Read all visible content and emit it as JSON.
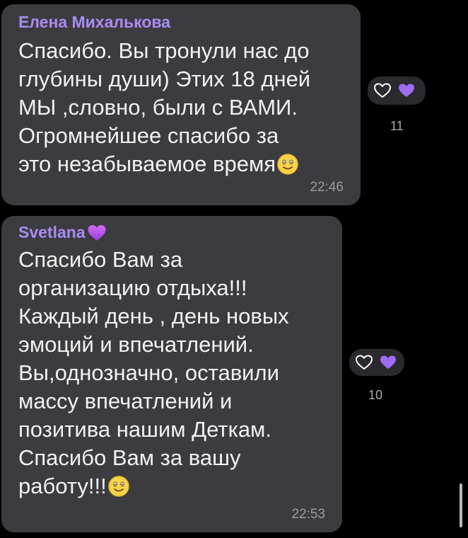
{
  "messages": [
    {
      "sender": "Елена Михалькова",
      "text": "Спасибо. Вы тронули нас до\nглубины души) Этих 18 дней\nМЫ ,словно, были с ВАМИ.\nОгромнейшее спасибо за\nэто незабываемое время",
      "time": "22:46",
      "reaction_count": "11",
      "trailing_emoji": "smiling-face-emoji"
    },
    {
      "sender": "Svetlana",
      "sender_badge": "purple-heart-icon",
      "text": "Спасибо Вам за\nорганизацию отдыха!!!\nКаждый день , день новых\nэмоций и впечатлений.\nВы,однозначно, оставили\nмассу впечатлений и\nпозитива нашим Деткам.\nСпасибо Вам за вашу\nработу!!!",
      "time": "22:53",
      "reaction_count": "10",
      "trailing_emoji": "smiling-face-emoji"
    }
  ],
  "colors": {
    "background": "#000000",
    "bubble": "#3c3c40",
    "sender_name": "#a98cf3",
    "heart": "#9f6bf0",
    "text": "#f2f2f2",
    "time": "#9a9aa0"
  }
}
